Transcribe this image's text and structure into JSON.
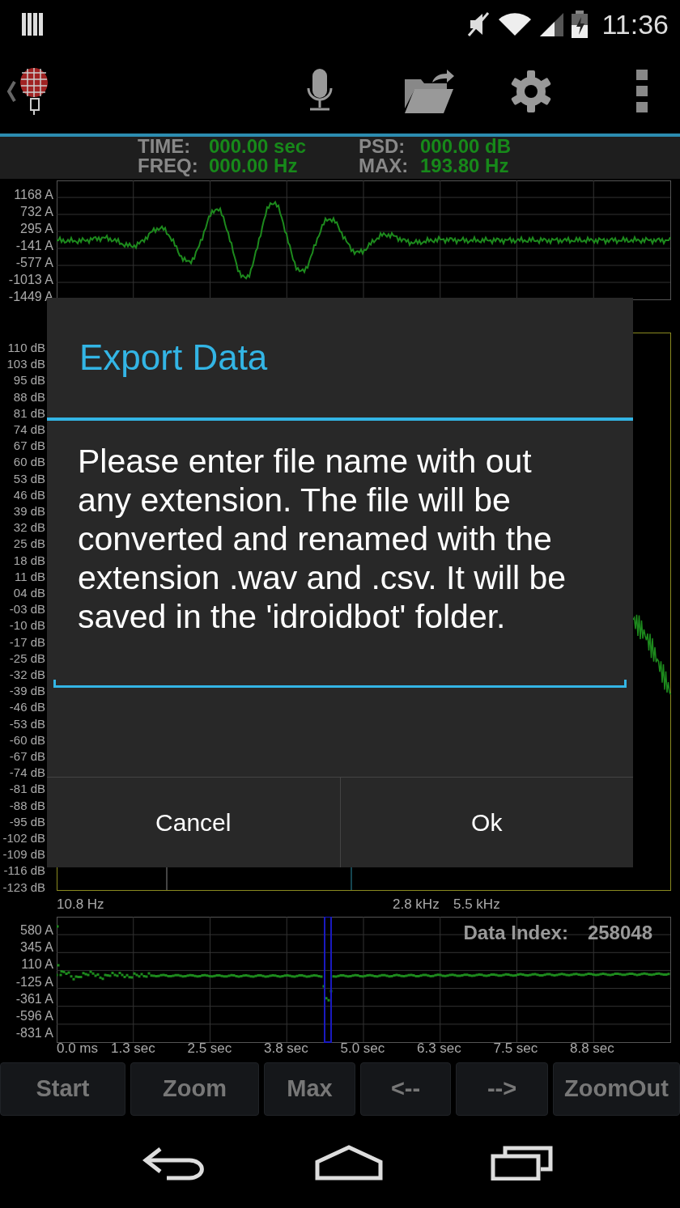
{
  "status_bar": {
    "time": "11:36"
  },
  "info": [
    {
      "label": "TIME:",
      "value": "000.00 sec"
    },
    {
      "label": "PSD:",
      "value": "000.00 dB"
    },
    {
      "label": "FREQ:",
      "value": "000.00 Hz"
    },
    {
      "label": "MAX:",
      "value": "193.80 Hz"
    }
  ],
  "waveform_chart": {
    "y_labels": [
      "1168 A",
      "732 A",
      "295 A",
      "-141 A",
      "-577 A",
      "-1013 A",
      "-1449 A"
    ]
  },
  "spectrum_chart": {
    "y_labels": [
      "110 dB",
      "103 dB",
      "95 dB",
      "88 dB",
      "81 dB",
      "74 dB",
      "67 dB",
      "60 dB",
      "53 dB",
      "46 dB",
      "39 dB",
      "32 dB",
      "25 dB",
      "18 dB",
      "11 dB",
      "04 dB",
      "-03 dB",
      "-10 dB",
      "-17 dB",
      "-25 dB",
      "-32 dB",
      "-39 dB",
      "-46 dB",
      "-53 dB",
      "-60 dB",
      "-67 dB",
      "-74 dB",
      "-81 dB",
      "-88 dB",
      "-95 dB",
      "-102 dB",
      "-109 dB",
      "-116 dB",
      "-123 dB"
    ],
    "x_labels": [
      "10.8 Hz",
      "2.8 kHz",
      "5.5 kHz"
    ]
  },
  "overview_chart": {
    "y_labels": [
      "580 A",
      "345 A",
      "110 A",
      "-125 A",
      "-361 A",
      "-596 A",
      "-831 A"
    ],
    "x_labels": [
      "0.0 ms",
      "1.3 sec",
      "2.5 sec",
      "3.8 sec",
      "5.0 sec",
      "6.3 sec",
      "7.5 sec",
      "8.8 sec"
    ],
    "data_index_label": "Data Index:",
    "data_index": "258048"
  },
  "buttons": [
    "Start",
    "Zoom",
    "Max",
    "<--",
    "-->",
    "ZoomOut"
  ],
  "dialog": {
    "title": "Export Data",
    "message": "Please enter file name with out any extension. The file will be converted and renamed with the extension .wav and .csv. It will be saved in the 'idroidbot' folder.",
    "buttons": [
      "Cancel",
      "Ok"
    ]
  }
}
